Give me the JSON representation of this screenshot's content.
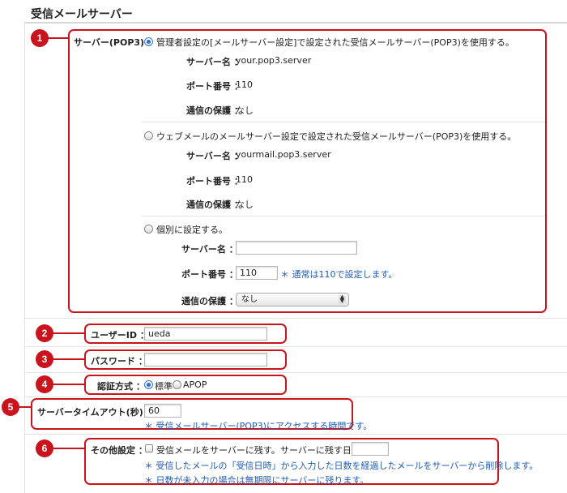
{
  "title": "受信メールサーバー",
  "markers": [
    "1",
    "2",
    "3",
    "4",
    "5",
    "6"
  ],
  "server": {
    "label": "サーバー(POP3) ：",
    "options": [
      {
        "label": "管理者設定の[メールサーバー設定]で設定された受信メールサーバー(POP3)を使用する。",
        "selected": true,
        "server_name_label": "サーバー名 ：",
        "server_name_value": "your.pop3.server",
        "port_label": "ポート番号 ：",
        "port_value": "110",
        "protect_label": "通信の保護 ：",
        "protect_value": "なし"
      },
      {
        "label": "ウェブメールのメールサーバー設定で設定された受信メールサーバー(POP3)を使用する。",
        "selected": false,
        "server_name_label": "サーバー名 ：",
        "server_name_value": "yourmail.pop3.server",
        "port_label": "ポート番号 ：",
        "port_value": "110",
        "protect_label": "通信の保護 ：",
        "protect_value": "なし"
      },
      {
        "label": "個別に設定する。",
        "selected": false,
        "server_name_label": "サーバー名 ：",
        "server_name_value": "",
        "port_label": "ポート番号 ：",
        "port_value": "110",
        "port_note": "＊ 通常は110で設定します。",
        "protect_label": "通信の保護 ：",
        "protect_value": "なし"
      }
    ]
  },
  "user_id": {
    "label": "ユーザーID ：",
    "value": "ueda"
  },
  "password": {
    "label": "パスワード ：",
    "value": ""
  },
  "auth": {
    "label": "認証方式 ：",
    "options": [
      "標準",
      "APOP"
    ],
    "selected": "標準"
  },
  "timeout": {
    "label": "サーバータイムアウト(秒) ：",
    "value": "60",
    "note": "＊ 受信メールサーバー(POP3)にアクセスする時間です。"
  },
  "other": {
    "label": "その他設定 ：",
    "checkbox_label": "受信メールをサーバーに残す。",
    "checked": false,
    "days_label": "サーバーに残す日数 ：",
    "days_value": "",
    "note1": "＊ 受信したメールの「受信日時」から入力した日数を経過したメールをサーバーから削除します。",
    "note2": "＊ 日数が未入力の場合は無期限にサーバーに残ります。"
  },
  "colors": {
    "accent_red": "#c9141e",
    "note_blue": "#1f5cb3"
  }
}
